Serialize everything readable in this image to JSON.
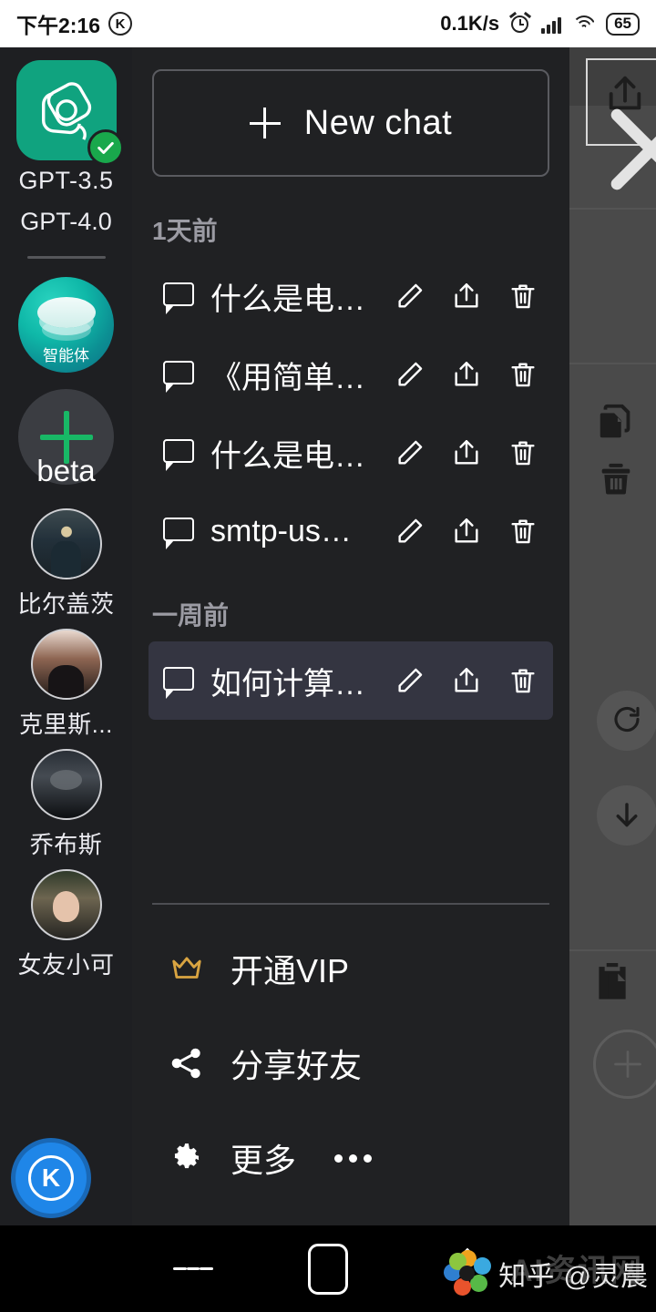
{
  "status_bar": {
    "time": "下午2:16",
    "app_badge": "K",
    "network_speed": "0.1K/s",
    "battery": "65",
    "icons": [
      "alarm-icon",
      "signal-icon",
      "wifi-icon",
      "battery-icon"
    ]
  },
  "rail": {
    "models": [
      {
        "label": "GPT-3.5",
        "icon": "openai-logo-icon",
        "selected": true
      },
      {
        "label": "GPT-4.0",
        "icon": "",
        "selected": false
      }
    ],
    "agent": {
      "label": "智能体",
      "icon": "agent-disc-icon"
    },
    "beta": {
      "label": "beta",
      "icon": "plus-icon"
    },
    "characters": [
      {
        "name": "比尔盖茨",
        "avatar": "avatar-bill-gates"
      },
      {
        "name": "克里斯...",
        "avatar": "avatar-chris"
      },
      {
        "name": "乔布斯",
        "avatar": "avatar-steve-jobs"
      },
      {
        "name": "女友小可",
        "avatar": "avatar-xiaoke"
      }
    ],
    "fab": {
      "label": "K",
      "icon": "k-circle-icon",
      "color": "#1f86e8"
    }
  },
  "panel": {
    "new_chat": {
      "label": "New chat",
      "icon": "plus-icon"
    },
    "groups": [
      {
        "label": "1天前",
        "items": [
          {
            "title": "什么是电…"
          },
          {
            "title": "《用简单…"
          },
          {
            "title": "什么是电…"
          },
          {
            "title": "smtp-us…"
          }
        ]
      },
      {
        "label": "一周前",
        "items": [
          {
            "title": "如何计算…",
            "active": true
          }
        ]
      }
    ],
    "row_actions": [
      "edit-icon",
      "share-icon",
      "delete-icon"
    ],
    "menu": [
      {
        "label": "开通VIP",
        "icon": "crown-icon",
        "icon_color": "#d9a441"
      },
      {
        "label": "分享好友",
        "icon": "share-nodes-icon",
        "icon_color": "#ffffff"
      },
      {
        "label": "更多",
        "icon": "gear-icon",
        "icon_color": "#ffffff",
        "trailing": "dots"
      }
    ]
  },
  "content_strip": {
    "icons": [
      "share-box-icon",
      "close-x-icon",
      "copy-icon",
      "delete-icon",
      "refresh-icon",
      "scroll-down-icon",
      "paste-icon",
      "add-circle-icon"
    ]
  },
  "navbar": {
    "buttons": [
      "recents-icon",
      "home-icon",
      "back-icon"
    ],
    "watermark": "知乎 @灵晨",
    "watermark_ghost": "AI资讯网"
  },
  "colors": {
    "drawer_bg": "#202123",
    "rail_bg": "#1e1f22",
    "active_row": "#343541",
    "accent_green": "#10a37f",
    "vip_gold": "#d9a441",
    "fab_blue": "#1f86e8"
  }
}
